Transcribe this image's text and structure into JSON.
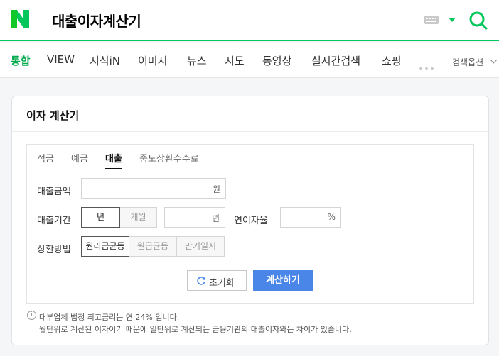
{
  "header": {
    "logo_icon": "naver-logo-icon",
    "query": "대출이자계산기",
    "keyboard_icon": "keyboard-icon",
    "dropdown_icon": "caret-down-icon",
    "search_icon": "search-icon",
    "accent": "#03c75a"
  },
  "nav": {
    "items": [
      "통합",
      "VIEW",
      "지식iN",
      "이미지",
      "뉴스",
      "지도",
      "동영상",
      "실시간검색",
      "쇼핑"
    ],
    "active": "통합",
    "more_icon": "more-dots-icon",
    "options_label": "검색옵션"
  },
  "calculator": {
    "title": "이자 계산기",
    "tabs": [
      "적금",
      "예금",
      "대출",
      "중도상환수수료"
    ],
    "active_tab": "대출",
    "amount": {
      "label": "대출금액",
      "value": "",
      "unit": "원"
    },
    "period": {
      "label": "대출기간",
      "options": [
        "년",
        "개월"
      ],
      "selected": "년",
      "value": "",
      "unit": "년"
    },
    "rate": {
      "label": "연이자율",
      "value": "",
      "unit": "%"
    },
    "method": {
      "label": "상환방법",
      "options": [
        "원리금균등",
        "원금균등",
        "만기일시"
      ],
      "selected": "원리금균등"
    },
    "reset_label": "초기화",
    "calc_label": "계산하기",
    "calc_color": "#4a86e8"
  },
  "notes": [
    "대부업체 법정 최고금리는 연 24% 입니다.",
    "월단위로 계산된 이자이기 때문에 일단위로 계산되는 금융기관의 대출이자와는 차이가 있습니다."
  ]
}
